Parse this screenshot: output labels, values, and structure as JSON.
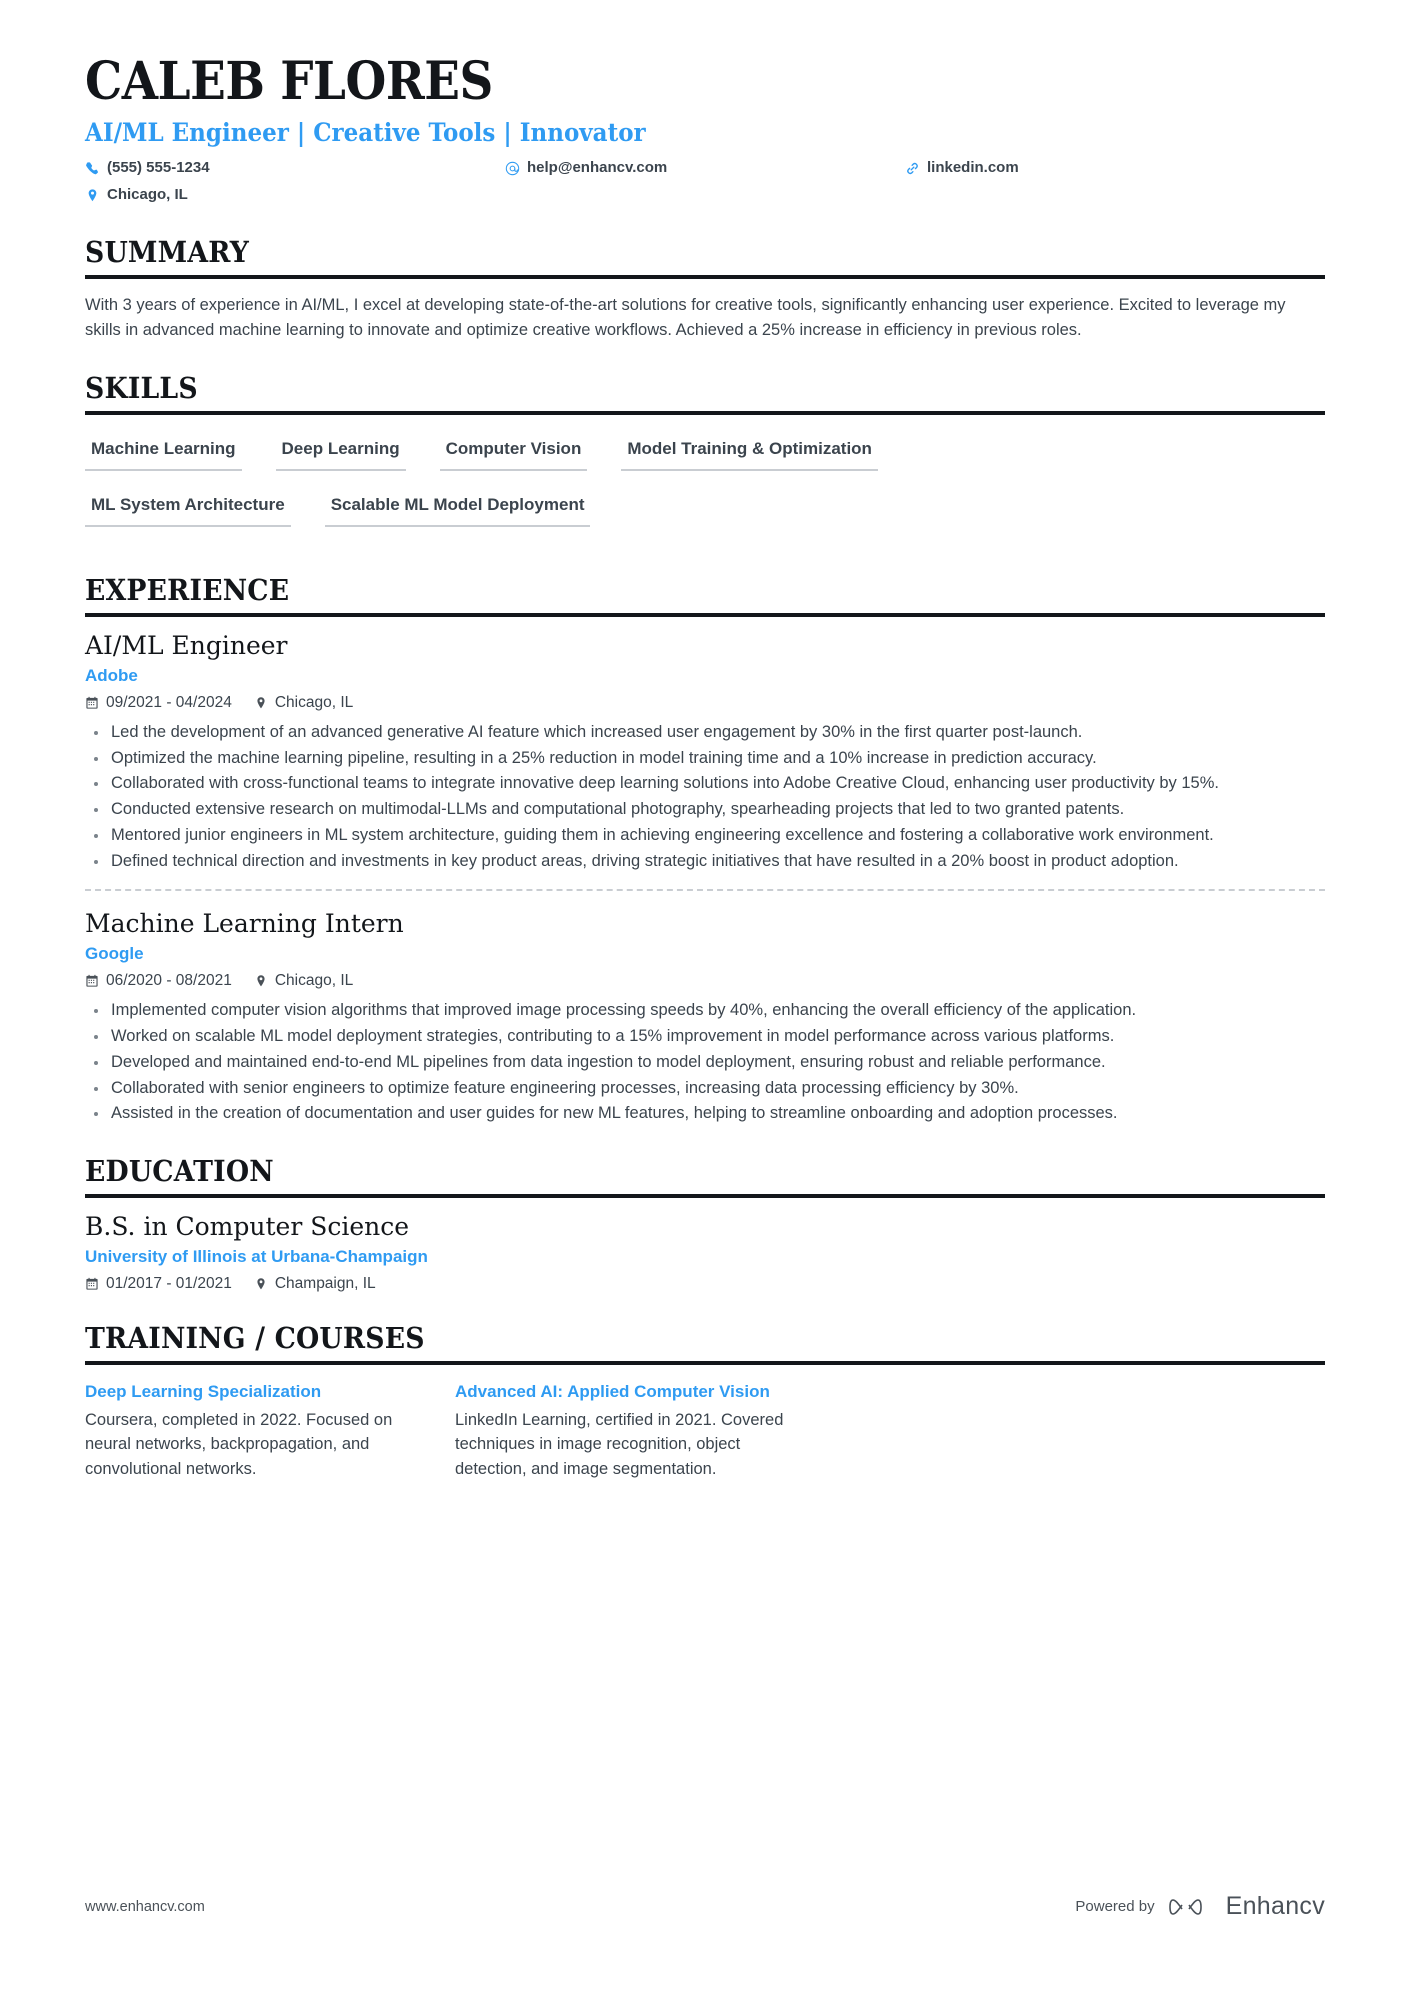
{
  "header": {
    "name": "CALEB FLORES",
    "headline": "AI/ML Engineer | Creative Tools | Innovator",
    "contacts": [
      {
        "icon": "phone-icon",
        "value": "(555) 555-1234"
      },
      {
        "icon": "email-icon",
        "value": "help@enhancv.com"
      },
      {
        "icon": "link-icon",
        "value": "linkedin.com"
      },
      {
        "icon": "location-icon",
        "value": "Chicago, IL"
      }
    ]
  },
  "accent_color": "#2f9bf2",
  "heading_color": "#13161a",
  "body_color": "#3b444d",
  "sections": {
    "summary": {
      "title": "SUMMARY",
      "text": "With 3 years of experience in AI/ML, I excel at developing state-of-the-art solutions for creative tools, significantly enhancing user experience. Excited to leverage my skills in advanced machine learning to innovate and optimize creative workflows. Achieved a 25% increase in efficiency in previous roles."
    },
    "skills": {
      "title": "SKILLS",
      "items": [
        "Machine Learning",
        "Deep Learning",
        "Computer Vision",
        "Model Training & Optimization",
        "ML System Architecture",
        "Scalable ML Model Deployment"
      ]
    },
    "experience": {
      "title": "EXPERIENCE",
      "entries": [
        {
          "role": "AI/ML Engineer",
          "company": "Adobe",
          "dates": "09/2021 - 04/2024",
          "location": "Chicago, IL",
          "bullets": [
            "Led the development of an advanced generative AI feature which increased user engagement by 30% in the first quarter post-launch.",
            "Optimized the machine learning pipeline, resulting in a 25% reduction in model training time and a 10% increase in prediction accuracy.",
            "Collaborated with cross-functional teams to integrate innovative deep learning solutions into Adobe Creative Cloud, enhancing user productivity by 15%.",
            "Conducted extensive research on multimodal-LLMs and computational photography, spearheading projects that led to two granted patents.",
            "Mentored junior engineers in ML system architecture, guiding them in achieving engineering excellence and fostering a collaborative work environment.",
            "Defined technical direction and investments in key product areas, driving strategic initiatives that have resulted in a 20% boost in product adoption."
          ]
        },
        {
          "role": "Machine Learning Intern",
          "company": "Google",
          "dates": "06/2020 - 08/2021",
          "location": "Chicago, IL",
          "bullets": [
            "Implemented computer vision algorithms that improved image processing speeds by 40%, enhancing the overall efficiency of the application.",
            "Worked on scalable ML model deployment strategies, contributing to a 15% improvement in model performance across various platforms.",
            "Developed and maintained end-to-end ML pipelines from data ingestion to model deployment, ensuring robust and reliable performance.",
            "Collaborated with senior engineers to optimize feature engineering processes, increasing data processing efficiency by 30%.",
            "Assisted in the creation of documentation and user guides for new ML features, helping to streamline onboarding and adoption processes."
          ]
        }
      ]
    },
    "education": {
      "title": "EDUCATION",
      "entries": [
        {
          "degree": "B.S. in Computer Science",
          "school": "University of Illinois at Urbana-Champaign",
          "dates": "01/2017 - 01/2021",
          "location": "Champaign, IL"
        }
      ]
    },
    "training": {
      "title": "TRAINING / COURSES",
      "courses": [
        {
          "title": "Deep Learning Specialization",
          "description": "Coursera, completed in 2022. Focused on neural networks, backpropagation, and convolutional networks."
        },
        {
          "title": "Advanced AI: Applied Computer Vision",
          "description": "LinkedIn Learning, certified in 2021. Covered techniques in image recognition, object detection, and image segmentation."
        }
      ]
    }
  },
  "footer": {
    "url": "www.enhancv.com",
    "powered_by": "Powered by",
    "brand": "Enhancv"
  }
}
